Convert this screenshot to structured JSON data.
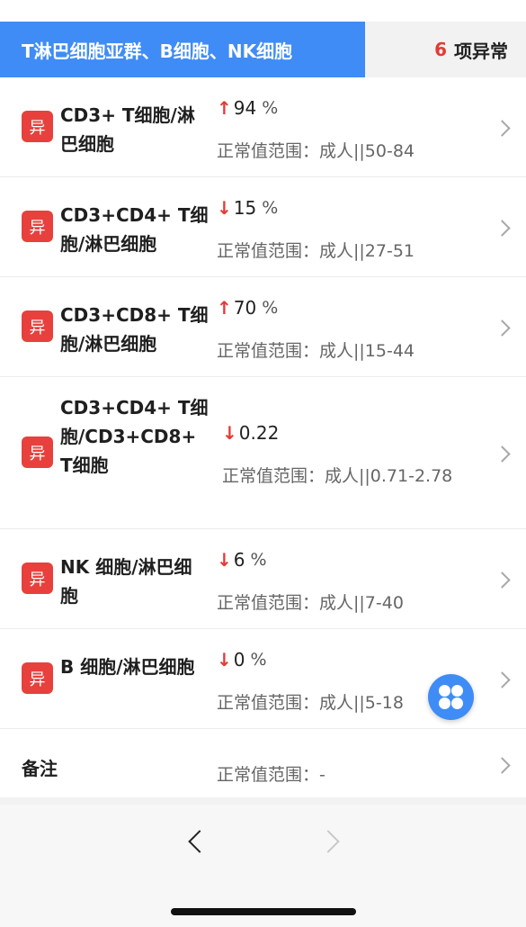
{
  "header": {
    "tab_title": "T淋巴细胞亚群、B细胞、NK细胞",
    "abnormal_count": "6",
    "abnormal_label": "项异常"
  },
  "badge_label": "异",
  "items": [
    {
      "name": "CD3+ T细胞/淋巴细胞",
      "direction": "up",
      "value": "94",
      "unit": "%",
      "range": "正常值范围：成人||50-84"
    },
    {
      "name": "CD3+CD4+ T细胞/淋巴细胞",
      "direction": "down",
      "value": "15",
      "unit": "%",
      "range": "正常值范围：成人||27-51"
    },
    {
      "name": "CD3+CD8+ T细胞/淋巴细胞",
      "direction": "up",
      "value": "70",
      "unit": "%",
      "range": "正常值范围：成人||15-44"
    },
    {
      "name": "CD3+CD4+ T细胞/CD3+CD8+ T细胞",
      "direction": "down",
      "value": "0.22",
      "unit": "",
      "range": "正常值范围：成人||0.71-2.78"
    },
    {
      "name": "NK 细胞/淋巴细胞",
      "direction": "down",
      "value": "6",
      "unit": "%",
      "range": "正常值范围：成人||7-40"
    },
    {
      "name": "B 细胞/淋巴细胞",
      "direction": "down",
      "value": "0",
      "unit": "%",
      "range": "正常值范围：成人||5-18"
    }
  ],
  "note": {
    "label": "备注",
    "range": "正常值范围：-"
  },
  "icons": {
    "up": "↑",
    "down": "↓",
    "prev": "chevron-left-icon",
    "next": "chevron-right-icon",
    "fab": "menu-dots-icon"
  },
  "colors": {
    "accent": "#3f8cf6",
    "abnormal": "#e53935"
  }
}
